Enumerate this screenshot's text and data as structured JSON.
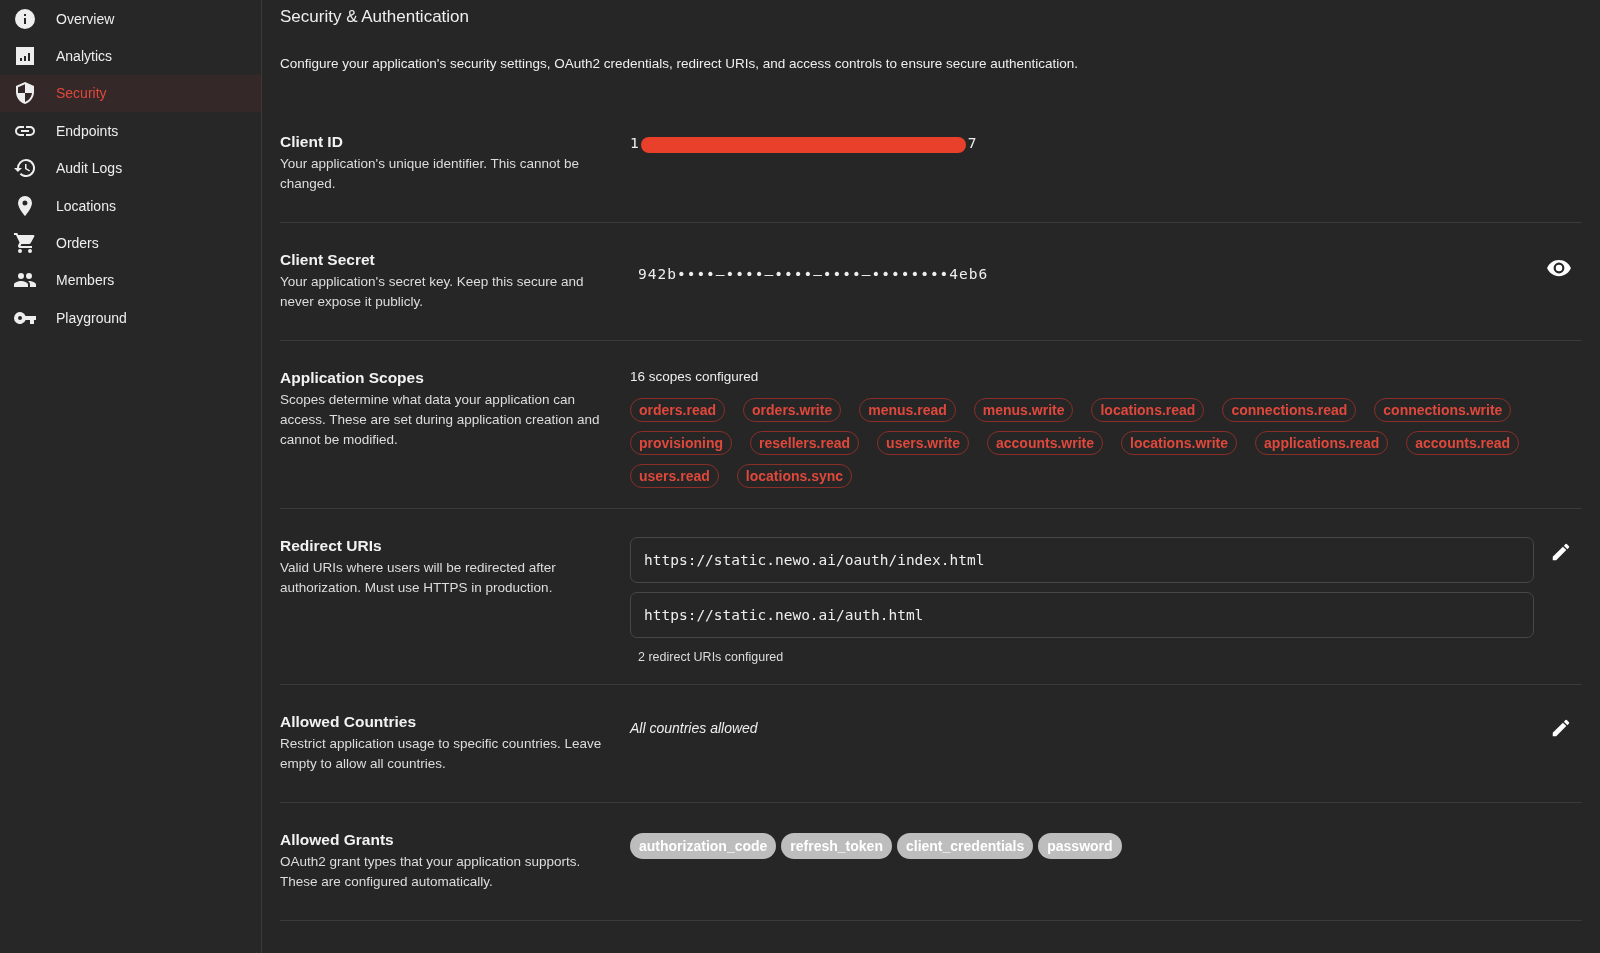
{
  "sidebar": {
    "items": [
      {
        "label": "Overview",
        "selected": false
      },
      {
        "label": "Analytics",
        "selected": false
      },
      {
        "label": "Security",
        "selected": true
      },
      {
        "label": "Endpoints",
        "selected": false
      },
      {
        "label": "Audit Logs",
        "selected": false
      },
      {
        "label": "Locations",
        "selected": false
      },
      {
        "label": "Orders",
        "selected": false
      },
      {
        "label": "Members",
        "selected": false
      },
      {
        "label": "Playground",
        "selected": false
      }
    ]
  },
  "page": {
    "title": "Security & Authentication",
    "description": "Configure your application's security settings, OAuth2 credentials, redirect URIs, and access controls to ensure secure authentication."
  },
  "sections": [
    {
      "kind": "id",
      "title": "Client ID",
      "description": "Your application's unique identifier. This cannot be changed.",
      "visible_start": "1",
      "visible_end": "7"
    },
    {
      "kind": "secret",
      "title": "Client Secret",
      "description": "Your application's secret key. Keep this secure and never expose it publicly.",
      "value": "942b••••–••••–••••–••••–••••••••4eb6"
    },
    {
      "kind": "scopes",
      "title": "Application Scopes",
      "description": "Scopes determine what data your application can access. These are set during application creation and cannot be modified.",
      "count": "16 scopes configured",
      "scopes": [
        "orders.read",
        "orders.write",
        "menus.read",
        "menus.write",
        "locations.read",
        "connections.read",
        "connections.write",
        "provisioning",
        "resellers.read",
        "users.write",
        "accounts.write",
        "locations.write",
        "applications.read",
        "accounts.read",
        "users.read",
        "locations.sync"
      ]
    },
    {
      "kind": "uris",
      "title": "Redirect URIs",
      "description": "Valid URIs where users will be redirected after authorization. Must use HTTPS in production.",
      "uris": [
        "https://static.newo.ai/oauth/index.html",
        "https://static.newo.ai/auth.html"
      ],
      "count": "2 redirect URIs configured"
    },
    {
      "kind": "text",
      "title": "Allowed Countries",
      "description": "Restrict application usage to specific countries. Leave empty to allow all countries.",
      "value": "All countries allowed"
    },
    {
      "kind": "chips",
      "title": "Allowed Grants",
      "description": "OAuth2 grant types that your application supports. These are configured automatically.",
      "chips": [
        "authorization_code",
        "refresh_token",
        "client_credentials",
        "password"
      ]
    }
  ]
}
